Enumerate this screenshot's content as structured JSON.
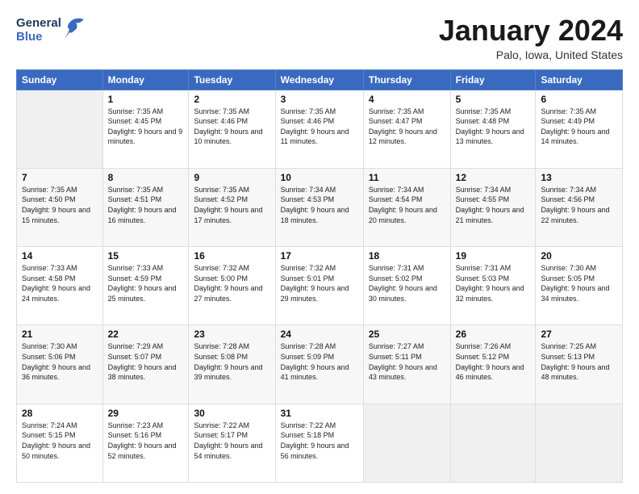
{
  "header": {
    "logo_general": "General",
    "logo_blue": "Blue",
    "month_title": "January 2024",
    "location": "Palo, Iowa, United States"
  },
  "days_of_week": [
    "Sunday",
    "Monday",
    "Tuesday",
    "Wednesday",
    "Thursday",
    "Friday",
    "Saturday"
  ],
  "weeks": [
    [
      {
        "day": "",
        "empty": true
      },
      {
        "day": "1",
        "sunrise": "Sunrise: 7:35 AM",
        "sunset": "Sunset: 4:45 PM",
        "daylight": "Daylight: 9 hours and 9 minutes."
      },
      {
        "day": "2",
        "sunrise": "Sunrise: 7:35 AM",
        "sunset": "Sunset: 4:46 PM",
        "daylight": "Daylight: 9 hours and 10 minutes."
      },
      {
        "day": "3",
        "sunrise": "Sunrise: 7:35 AM",
        "sunset": "Sunset: 4:46 PM",
        "daylight": "Daylight: 9 hours and 11 minutes."
      },
      {
        "day": "4",
        "sunrise": "Sunrise: 7:35 AM",
        "sunset": "Sunset: 4:47 PM",
        "daylight": "Daylight: 9 hours and 12 minutes."
      },
      {
        "day": "5",
        "sunrise": "Sunrise: 7:35 AM",
        "sunset": "Sunset: 4:48 PM",
        "daylight": "Daylight: 9 hours and 13 minutes."
      },
      {
        "day": "6",
        "sunrise": "Sunrise: 7:35 AM",
        "sunset": "Sunset: 4:49 PM",
        "daylight": "Daylight: 9 hours and 14 minutes."
      }
    ],
    [
      {
        "day": "7",
        "sunrise": "Sunrise: 7:35 AM",
        "sunset": "Sunset: 4:50 PM",
        "daylight": "Daylight: 9 hours and 15 minutes."
      },
      {
        "day": "8",
        "sunrise": "Sunrise: 7:35 AM",
        "sunset": "Sunset: 4:51 PM",
        "daylight": "Daylight: 9 hours and 16 minutes."
      },
      {
        "day": "9",
        "sunrise": "Sunrise: 7:35 AM",
        "sunset": "Sunset: 4:52 PM",
        "daylight": "Daylight: 9 hours and 17 minutes."
      },
      {
        "day": "10",
        "sunrise": "Sunrise: 7:34 AM",
        "sunset": "Sunset: 4:53 PM",
        "daylight": "Daylight: 9 hours and 18 minutes."
      },
      {
        "day": "11",
        "sunrise": "Sunrise: 7:34 AM",
        "sunset": "Sunset: 4:54 PM",
        "daylight": "Daylight: 9 hours and 20 minutes."
      },
      {
        "day": "12",
        "sunrise": "Sunrise: 7:34 AM",
        "sunset": "Sunset: 4:55 PM",
        "daylight": "Daylight: 9 hours and 21 minutes."
      },
      {
        "day": "13",
        "sunrise": "Sunrise: 7:34 AM",
        "sunset": "Sunset: 4:56 PM",
        "daylight": "Daylight: 9 hours and 22 minutes."
      }
    ],
    [
      {
        "day": "14",
        "sunrise": "Sunrise: 7:33 AM",
        "sunset": "Sunset: 4:58 PM",
        "daylight": "Daylight: 9 hours and 24 minutes."
      },
      {
        "day": "15",
        "sunrise": "Sunrise: 7:33 AM",
        "sunset": "Sunset: 4:59 PM",
        "daylight": "Daylight: 9 hours and 25 minutes."
      },
      {
        "day": "16",
        "sunrise": "Sunrise: 7:32 AM",
        "sunset": "Sunset: 5:00 PM",
        "daylight": "Daylight: 9 hours and 27 minutes."
      },
      {
        "day": "17",
        "sunrise": "Sunrise: 7:32 AM",
        "sunset": "Sunset: 5:01 PM",
        "daylight": "Daylight: 9 hours and 29 minutes."
      },
      {
        "day": "18",
        "sunrise": "Sunrise: 7:31 AM",
        "sunset": "Sunset: 5:02 PM",
        "daylight": "Daylight: 9 hours and 30 minutes."
      },
      {
        "day": "19",
        "sunrise": "Sunrise: 7:31 AM",
        "sunset": "Sunset: 5:03 PM",
        "daylight": "Daylight: 9 hours and 32 minutes."
      },
      {
        "day": "20",
        "sunrise": "Sunrise: 7:30 AM",
        "sunset": "Sunset: 5:05 PM",
        "daylight": "Daylight: 9 hours and 34 minutes."
      }
    ],
    [
      {
        "day": "21",
        "sunrise": "Sunrise: 7:30 AM",
        "sunset": "Sunset: 5:06 PM",
        "daylight": "Daylight: 9 hours and 36 minutes."
      },
      {
        "day": "22",
        "sunrise": "Sunrise: 7:29 AM",
        "sunset": "Sunset: 5:07 PM",
        "daylight": "Daylight: 9 hours and 38 minutes."
      },
      {
        "day": "23",
        "sunrise": "Sunrise: 7:28 AM",
        "sunset": "Sunset: 5:08 PM",
        "daylight": "Daylight: 9 hours and 39 minutes."
      },
      {
        "day": "24",
        "sunrise": "Sunrise: 7:28 AM",
        "sunset": "Sunset: 5:09 PM",
        "daylight": "Daylight: 9 hours and 41 minutes."
      },
      {
        "day": "25",
        "sunrise": "Sunrise: 7:27 AM",
        "sunset": "Sunset: 5:11 PM",
        "daylight": "Daylight: 9 hours and 43 minutes."
      },
      {
        "day": "26",
        "sunrise": "Sunrise: 7:26 AM",
        "sunset": "Sunset: 5:12 PM",
        "daylight": "Daylight: 9 hours and 46 minutes."
      },
      {
        "day": "27",
        "sunrise": "Sunrise: 7:25 AM",
        "sunset": "Sunset: 5:13 PM",
        "daylight": "Daylight: 9 hours and 48 minutes."
      }
    ],
    [
      {
        "day": "28",
        "sunrise": "Sunrise: 7:24 AM",
        "sunset": "Sunset: 5:15 PM",
        "daylight": "Daylight: 9 hours and 50 minutes."
      },
      {
        "day": "29",
        "sunrise": "Sunrise: 7:23 AM",
        "sunset": "Sunset: 5:16 PM",
        "daylight": "Daylight: 9 hours and 52 minutes."
      },
      {
        "day": "30",
        "sunrise": "Sunrise: 7:22 AM",
        "sunset": "Sunset: 5:17 PM",
        "daylight": "Daylight: 9 hours and 54 minutes."
      },
      {
        "day": "31",
        "sunrise": "Sunrise: 7:22 AM",
        "sunset": "Sunset: 5:18 PM",
        "daylight": "Daylight: 9 hours and 56 minutes."
      },
      {
        "day": "",
        "empty": true
      },
      {
        "day": "",
        "empty": true
      },
      {
        "day": "",
        "empty": true
      }
    ]
  ]
}
